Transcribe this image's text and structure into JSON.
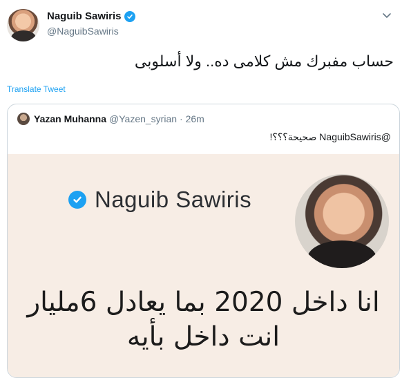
{
  "tweet": {
    "author_name": "Naguib Sawiris",
    "author_handle": "@NaguibSawiris",
    "text": "حساب مفبرك مش كلامى ده.. ولا أسلوبى",
    "translate_label": "Translate Tweet"
  },
  "quoted": {
    "author_name": "Yazan Muhanna",
    "author_handle": "@Yazen_syrian",
    "time": "· 26m",
    "text": "@NaguibSawiris صحيحة؟؟؟!",
    "image": {
      "name": "Naguib Sawiris",
      "line1": "انا داخل 2020 بما يعادل 6مليار",
      "line2": "انت داخل بأيه"
    }
  },
  "colors": {
    "accent": "#1da1f2",
    "handle": "#657786",
    "border": "#ccd6dd",
    "image_bg": "#f7ede5"
  },
  "icons": [
    "verified-badge-icon",
    "chevron-down-icon"
  ]
}
